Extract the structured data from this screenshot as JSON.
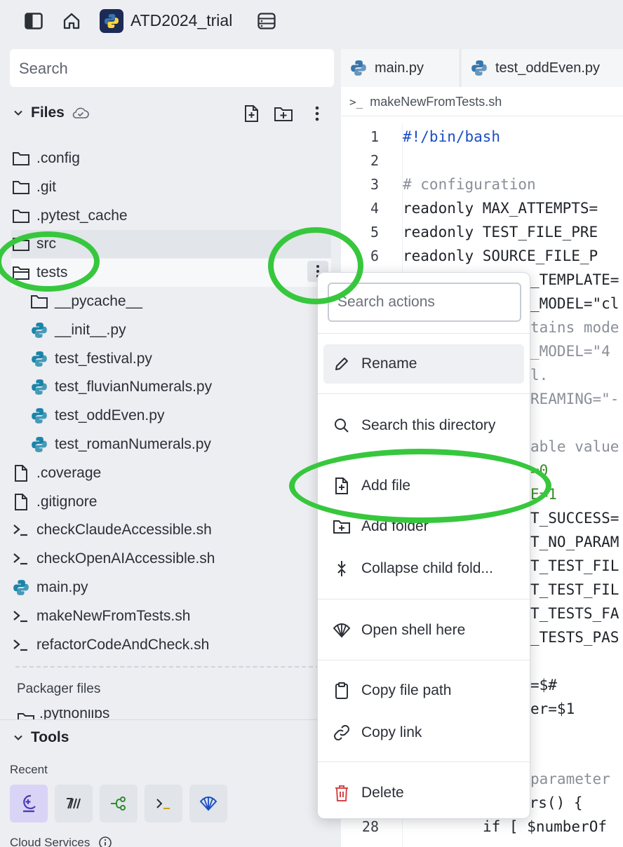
{
  "app": {
    "title": "ATD2024_trial",
    "icons": [
      "sidebar-toggle-icon",
      "home-icon",
      "python-logo-icon",
      "project-menu-icon"
    ]
  },
  "sidebar": {
    "search_placeholder": "Search",
    "files_label": "Files",
    "tree": [
      {
        "name": ".config",
        "icon": "folder-icon"
      },
      {
        "name": ".git",
        "icon": "folder-icon"
      },
      {
        "name": ".pytest_cache",
        "icon": "folder-icon"
      },
      {
        "name": "src",
        "icon": "folder-icon"
      },
      {
        "name": "tests",
        "icon": "folder-open-icon"
      },
      {
        "name": "__pycache__",
        "icon": "folder-icon"
      },
      {
        "name": "__init__.py",
        "icon": "python-icon"
      },
      {
        "name": "test_festival.py",
        "icon": "python-icon"
      },
      {
        "name": "test_fluvianNumerals.py",
        "icon": "python-icon"
      },
      {
        "name": "test_oddEven.py",
        "icon": "python-icon"
      },
      {
        "name": "test_romanNumerals.py",
        "icon": "python-icon"
      },
      {
        "name": ".coverage",
        "icon": "file-icon"
      },
      {
        "name": ".gitignore",
        "icon": "file-icon"
      },
      {
        "name": "checkClaudeAccessible.sh",
        "icon": "shell-icon"
      },
      {
        "name": "checkOpenAIAccessible.sh",
        "icon": "shell-icon"
      },
      {
        "name": "main.py",
        "icon": "python-icon"
      },
      {
        "name": "makeNewFromTests.sh",
        "icon": "shell-icon"
      },
      {
        "name": "refactorCodeAndCheck.sh",
        "icon": "shell-icon"
      }
    ],
    "packager_label": "Packager files",
    "pythonlibs": ".pythonlibs",
    "tools_label": "Tools",
    "recent_label": "Recent",
    "cloud_label": "Cloud Services"
  },
  "editor": {
    "tabs": [
      {
        "label": "main.py",
        "icon": "python-icon"
      },
      {
        "label": "test_oddEven.py",
        "icon": "python-icon"
      }
    ],
    "breadcrumb_prompt": ">_",
    "breadcrumb": "makeNewFromTests.sh",
    "line_numbers": [
      "1",
      "2",
      "3",
      "4",
      "5",
      "6",
      "28"
    ],
    "lines": [
      {
        "text": "#!/bin/bash",
        "color": "#1a4fc4"
      },
      {
        "text": "",
        "color": "#000000"
      },
      {
        "text": "# configuration",
        "color": "#8a8f98"
      },
      {
        "text": "readonly MAX_ATTEMPTS=",
        "color": "#1f2329"
      },
      {
        "text": "readonly TEST_FILE_PRE",
        "color": "#1f2329"
      },
      {
        "text": "readonly SOURCE_FILE_P",
        "color": "#1f2329"
      }
    ],
    "peek_lines": [
      {
        "text": "_TEMPLATE=",
        "color": "#1f2329"
      },
      {
        "text": "_MODEL=\"cl",
        "color": "#1f2329"
      },
      {
        "text": "tains mode",
        "color": "#8a8f98"
      },
      {
        "text": "_MODEL=\"4",
        "color": "#8a8f98"
      },
      {
        "text": "l.",
        "color": "#8a8f98"
      },
      {
        "text": "REAMING=\"-",
        "color": "#8a8f98"
      },
      {
        "text": "",
        "color": "#000000"
      },
      {
        "text": "able value",
        "color": "#8a8f98"
      },
      {
        "text": "=0",
        "color": "#3a8a2a"
      },
      {
        "text": "E=1",
        "color": "#3a8a2a"
      },
      {
        "text": "T_SUCCESS=",
        "color": "#1f2329"
      },
      {
        "text": "T_NO_PARAM",
        "color": "#1f2329"
      },
      {
        "text": "T_TEST_FIL",
        "color": "#1f2329"
      },
      {
        "text": "T_TEST_FIL",
        "color": "#1f2329"
      },
      {
        "text": "T_TESTS_FA",
        "color": "#1f2329"
      },
      {
        "text": "_TESTS_PAS",
        "color": "#1f2329"
      },
      {
        "text": "",
        "color": "#000000"
      },
      {
        "text": "=$#",
        "color": "#1f2329"
      },
      {
        "text": "er=$1",
        "color": "#1f2329"
      }
    ],
    "tail_lines": [
      {
        "text": "parameter",
        "color": "#8a8f98"
      },
      {
        "text": "ers() {",
        "color": "#1f2329"
      },
      {
        "text": "if [ $numberOf",
        "color": "#1f2329"
      }
    ]
  },
  "menu": {
    "search_placeholder": "Search actions",
    "items": [
      {
        "label": "Rename",
        "icon": "pencil-icon"
      },
      {
        "label": "Search this directory",
        "icon": "search-icon"
      },
      {
        "label": "Add file",
        "icon": "add-file-icon"
      },
      {
        "label": "Add folder",
        "icon": "add-folder-icon"
      },
      {
        "label": "Collapse child fold...",
        "icon": "collapse-icon"
      },
      {
        "label": "Open shell here",
        "icon": "shell-shell-icon"
      },
      {
        "label": "Copy file path",
        "icon": "clipboard-icon"
      },
      {
        "label": "Copy link",
        "icon": "link-icon"
      },
      {
        "label": "Delete",
        "icon": "trash-icon"
      }
    ]
  },
  "colors": {
    "accent_ring": "#37c73d",
    "delete": "#d64545",
    "python_blue": "#3776ab",
    "python_yellow": "#ffd43b"
  }
}
